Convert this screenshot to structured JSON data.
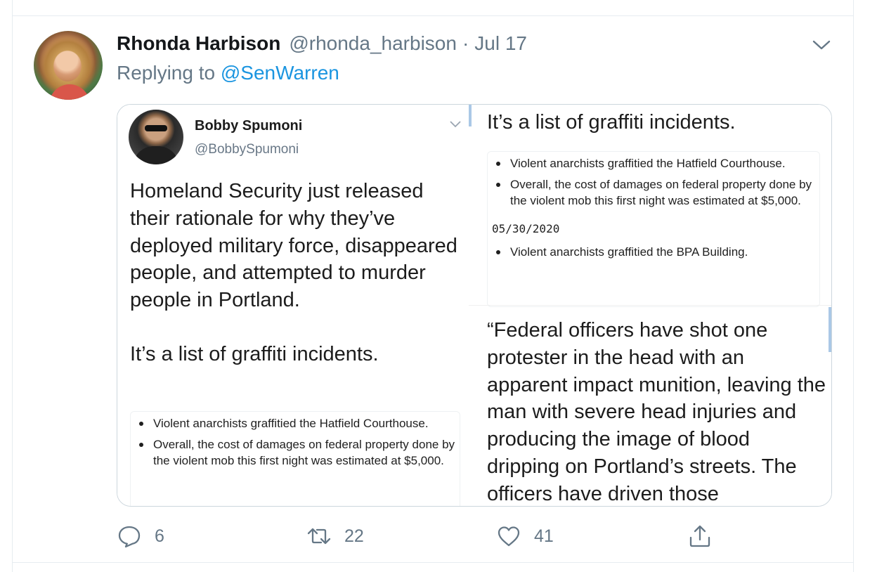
{
  "tweet": {
    "author_name": "Rhonda Harbison",
    "author_handle": "@rhonda_harbison",
    "separator": "·",
    "date": "Jul 17",
    "replying_prefix": "Replying to",
    "replying_to": "@SenWarren",
    "actions": {
      "reply_count": "6",
      "retweet_count": "22",
      "like_count": "41"
    }
  },
  "embedded_image": {
    "left_panel": {
      "author_name": "Bobby Spumoni",
      "author_handle": "@BobbySpumoni",
      "paragraphs": [
        "Homeland Security just released their rationale for why they’ve deployed military force, disappeared people, and attempted to murder people in Portland.",
        "It’s a list of graffiti incidents."
      ],
      "bullets": [
        "Violent anarchists graffitied the Hatfield Courthouse.",
        "Overall, the cost of damages on federal property done by the violent mob this first night was estimated at $5,000."
      ]
    },
    "right_panel": {
      "title": "It’s a list of graffiti incidents.",
      "bullets": [
        "Violent anarchists graffitied the Hatfield Courthouse.",
        "Overall, the cost of damages on federal property done by the violent mob this first night was estimated at $5,000."
      ],
      "date_label": "05/30/2020",
      "bullets_2": [
        "Violent anarchists graffitied the BPA Building."
      ],
      "quote": "“Federal officers have shot one protester in the head with an apparent impact munition, leaving the man with severe head injuries and producing the image of blood dripping on Portland’s streets. The officers have driven those"
    }
  },
  "colors": {
    "link": "#1b95e0",
    "secondary_text": "#657786",
    "border": "#ccd6dd"
  },
  "icons": {
    "more": "chevron-down-icon",
    "reply": "reply-icon",
    "retweet": "retweet-icon",
    "like": "heart-icon",
    "share": "share-icon"
  }
}
